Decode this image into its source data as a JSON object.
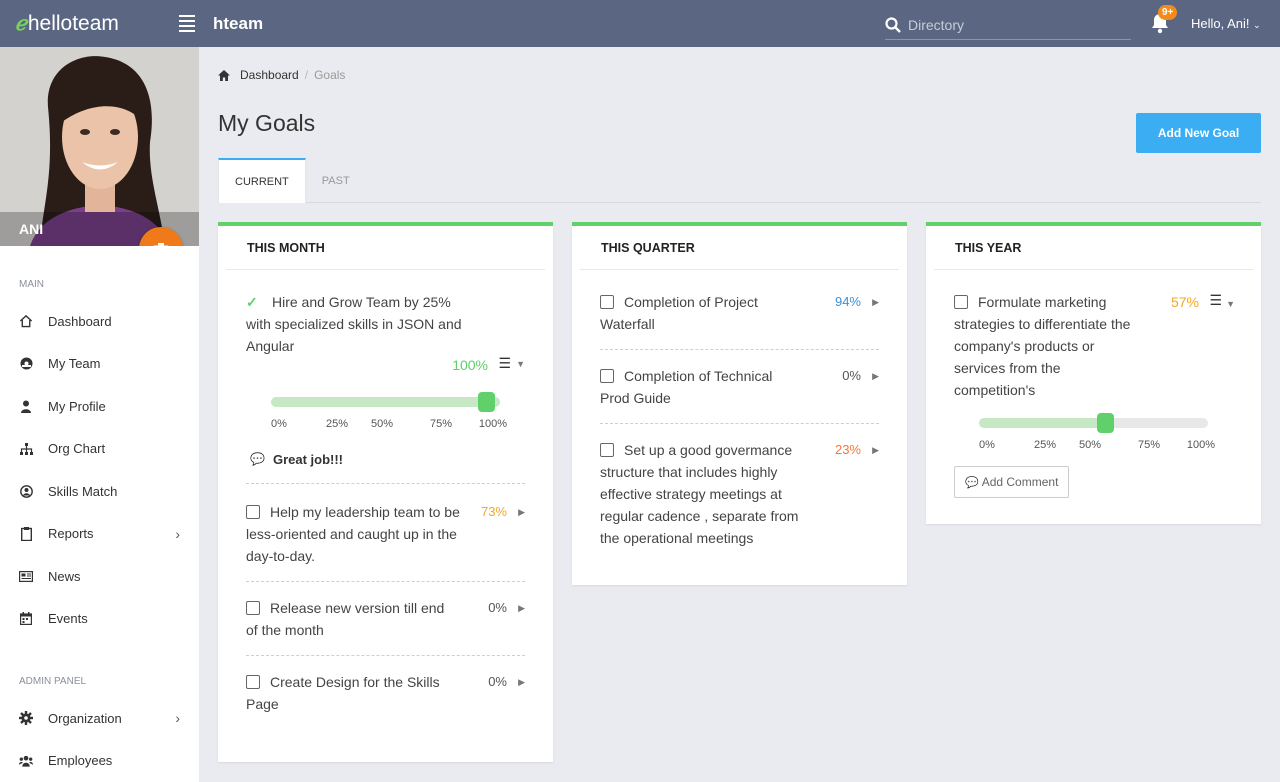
{
  "header": {
    "logo": "helloteam",
    "app_name": "hteam",
    "search_placeholder": "Directory",
    "notifications_badge": "9+",
    "user_greeting": "Hello, Ani!"
  },
  "profile": {
    "name": "ANI"
  },
  "sidebar": {
    "main_label": "MAIN",
    "items": [
      {
        "label": "Dashboard",
        "icon": "home-icon"
      },
      {
        "label": "My Team",
        "icon": "team-icon"
      },
      {
        "label": "My Profile",
        "icon": "user-icon"
      },
      {
        "label": "Org Chart",
        "icon": "org-chart-icon"
      },
      {
        "label": "Skills Match",
        "icon": "skills-icon"
      },
      {
        "label": "Reports",
        "icon": "clipboard-icon"
      },
      {
        "label": "News",
        "icon": "news-icon"
      },
      {
        "label": "Events",
        "icon": "calendar-icon"
      }
    ],
    "admin_label": "ADMIN PANEL",
    "admin_items": [
      {
        "label": "Organization",
        "icon": "gear-icon"
      },
      {
        "label": "Employees",
        "icon": "employees-icon"
      }
    ]
  },
  "breadcrumb": {
    "home": "Dashboard",
    "current": "Goals"
  },
  "page": {
    "title": "My Goals",
    "add_button": "Add New Goal"
  },
  "tabs": [
    {
      "label": "CURRENT"
    },
    {
      "label": "PAST"
    }
  ],
  "colors": {
    "accent": "#3badf2",
    "green": "#5fd06a",
    "orange": "#f5a623",
    "topbar": "#5b6782"
  },
  "month": {
    "title": "THIS MONTH",
    "goals": [
      {
        "text": "Hire and Grow Team by 25% with specialized skills in JSON and Angular",
        "pct": "100%",
        "completed": true,
        "progress": 1.0,
        "comment": "Great job!!!"
      },
      {
        "text": "Help my leadership team to be less-oriented and caught up in the day-to-day.",
        "pct": "73%"
      },
      {
        "text": "Release new version till end of the month",
        "pct": "0%"
      },
      {
        "text": "Create Design for the Skills Page",
        "pct": "0%"
      }
    ]
  },
  "quarter": {
    "title": "THIS QUARTER",
    "goals": [
      {
        "text": "Completion of Project Waterfall",
        "pct": "94%"
      },
      {
        "text": "Completion of Technical Prod Guide",
        "pct": "0%"
      },
      {
        "text": "Set up a good govermance structure that includes highly effective strategy meetings at regular cadence , separate from the operational meetings",
        "pct": "23%"
      }
    ]
  },
  "year": {
    "title": "THIS YEAR",
    "goals": [
      {
        "text": "Formulate marketing strategies to differentiate the company's products or services from the competition's",
        "pct": "57%",
        "progress": 0.57
      }
    ],
    "comment_button": "Add Comment"
  },
  "slider_ticks": [
    "0%",
    "25%",
    "50%",
    "75%",
    "100%"
  ]
}
